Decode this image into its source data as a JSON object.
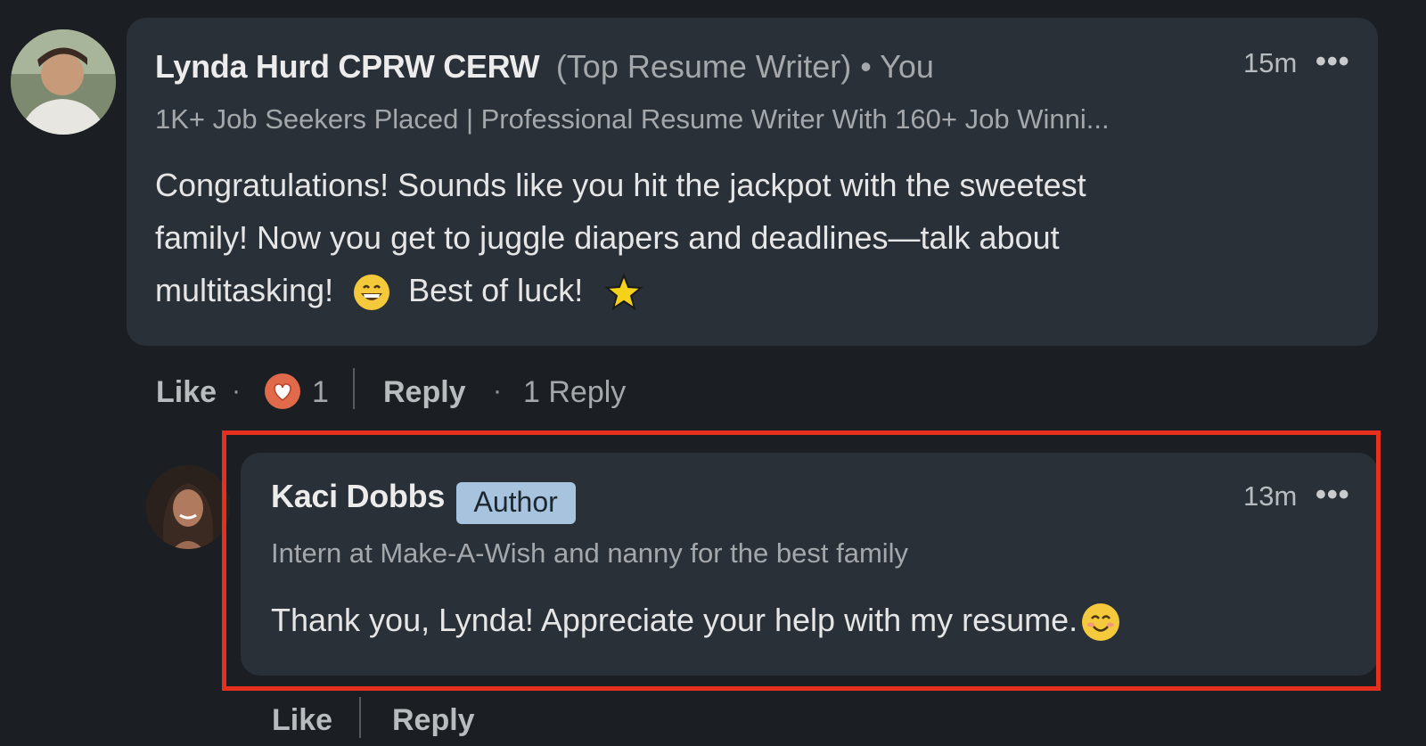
{
  "comment": {
    "author_name": "Lynda Hurd CPRW CERW",
    "author_tag": "(Top Resume Writer) • You",
    "headline": "1K+ Job Seekers Placed | Professional Resume Writer With 160+ Job Winni...",
    "time": "15m",
    "more": "•••",
    "text_line1": "Congratulations! Sounds like you hit the jackpot with the sweetest",
    "text_line2": "family! Now you get to juggle diapers and deadlines—talk about",
    "text_line3_a": "multitasking!",
    "text_line3_b": "Best of luck!",
    "emoji1": "grinning-face-emoji",
    "emoji2": "sparkle-star-emoji",
    "actions": {
      "like": "Like",
      "reaction_icon": "heart-reaction-icon",
      "reaction_count": "1",
      "reply": "Reply",
      "replies": "1 Reply"
    }
  },
  "reply": {
    "author_name": "Kaci Dobbs",
    "badge": "Author",
    "headline": "Intern at Make-A-Wish and nanny for the best family",
    "time": "13m",
    "more": "•••",
    "text": "Thank you, Lynda! Appreciate your help with my resume.",
    "emoji": "smiling-face-emoji",
    "actions": {
      "like": "Like",
      "reply": "Reply"
    }
  },
  "colors": {
    "background": "#1b1f23",
    "bubble": "#293038",
    "highlight_border": "#e4301c",
    "badge": "#a8c3dd"
  }
}
